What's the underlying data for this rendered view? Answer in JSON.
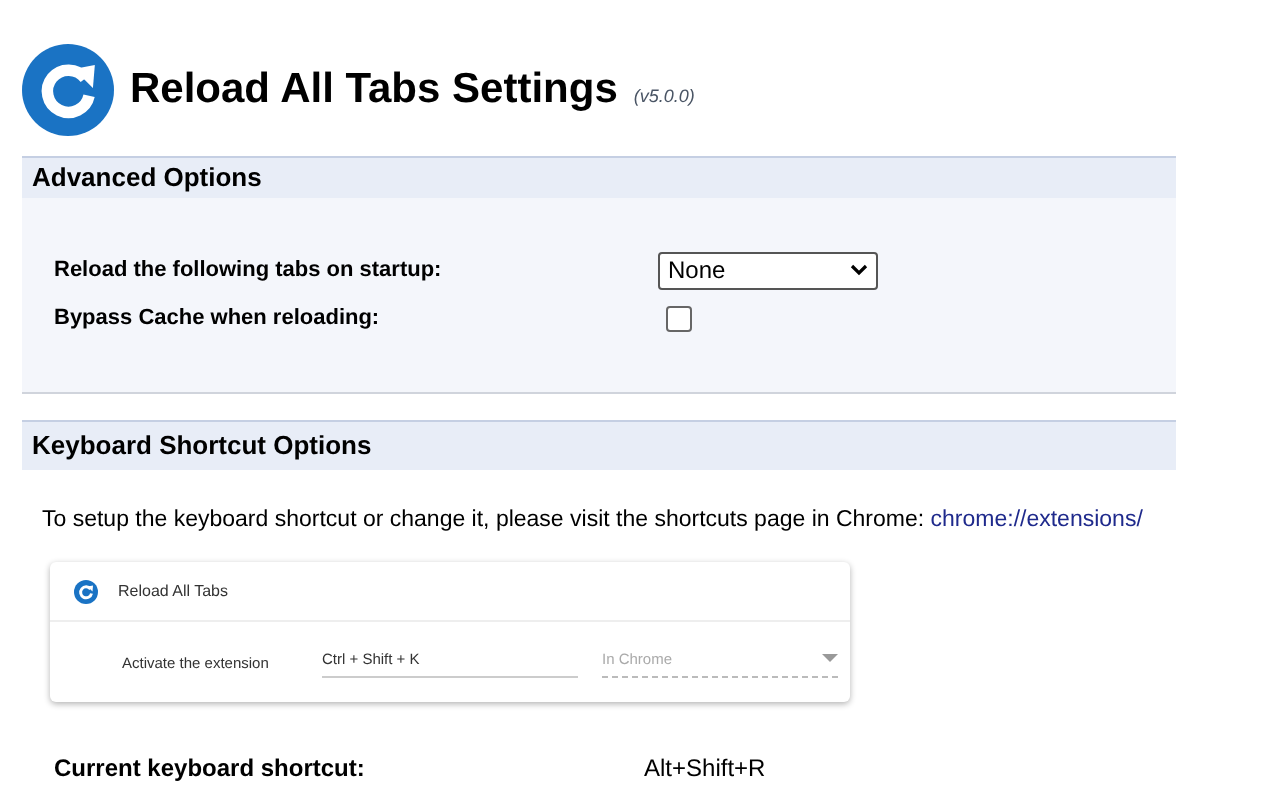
{
  "header": {
    "title": "Reload All Tabs Settings",
    "version": "(v5.0.0)"
  },
  "advanced": {
    "title": "Advanced Options",
    "startup": {
      "label": "Reload the following tabs on startup:",
      "value": "None"
    },
    "bypass": {
      "label": "Bypass Cache when reloading:",
      "checked": false
    }
  },
  "keyboard": {
    "title": "Keyboard Shortcut Options",
    "instruction": "To setup the keyboard shortcut or change it, please visit the shortcuts page in Chrome:",
    "link": "chrome://extensions/",
    "preview": {
      "name": "Reload All Tabs",
      "action": "Activate the extension",
      "shortcut": "Ctrl + Shift + K",
      "scope": "In Chrome"
    },
    "current": {
      "label": "Current keyboard shortcut:",
      "value": "Alt+Shift+R"
    }
  }
}
